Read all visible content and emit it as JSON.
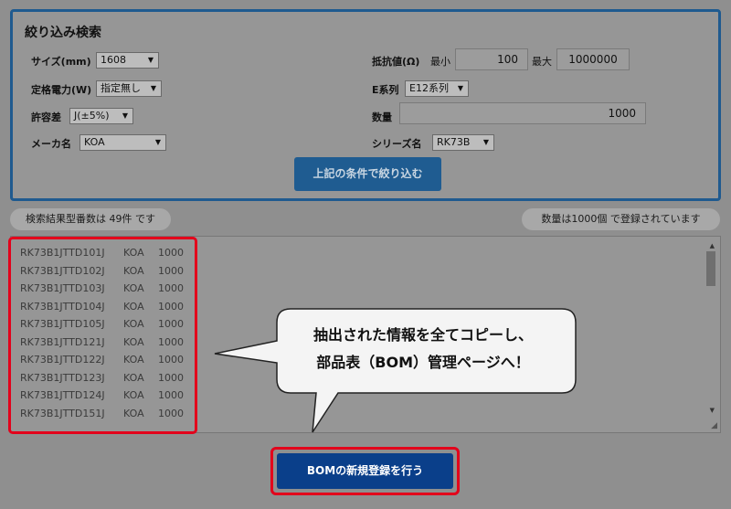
{
  "search": {
    "title": "絞り込み検索",
    "size": {
      "label": "サイズ(mm)",
      "value": "1608"
    },
    "power": {
      "label": "定格電力(W)",
      "value": "指定無し"
    },
    "tolerance": {
      "label": "許容差",
      "value": "J(±5%)"
    },
    "maker": {
      "label": "メーカ名",
      "value": "KOA"
    },
    "resistance": {
      "label": "抵抗値(Ω)",
      "min_label": "最小",
      "min_value": "100",
      "max_label": "最大",
      "max_value": "1000000"
    },
    "e_series": {
      "label": "E系列",
      "value": "E12系列"
    },
    "quantity": {
      "label": "数量",
      "value": "1000"
    },
    "series": {
      "label": "シリーズ名",
      "value": "RK73B"
    },
    "filter_button": "上記の条件で絞り込む"
  },
  "status": {
    "count_text": "検索結果型番数は 49件 です",
    "qty_text": "数量は1000個 で登録されています"
  },
  "results": [
    {
      "part": "RK73B1JTTD101J",
      "maker": "KOA",
      "qty": "1000"
    },
    {
      "part": "RK73B1JTTD102J",
      "maker": "KOA",
      "qty": "1000"
    },
    {
      "part": "RK73B1JTTD103J",
      "maker": "KOA",
      "qty": "1000"
    },
    {
      "part": "RK73B1JTTD104J",
      "maker": "KOA",
      "qty": "1000"
    },
    {
      "part": "RK73B1JTTD105J",
      "maker": "KOA",
      "qty": "1000"
    },
    {
      "part": "RK73B1JTTD121J",
      "maker": "KOA",
      "qty": "1000"
    },
    {
      "part": "RK73B1JTTD122J",
      "maker": "KOA",
      "qty": "1000"
    },
    {
      "part": "RK73B1JTTD123J",
      "maker": "KOA",
      "qty": "1000"
    },
    {
      "part": "RK73B1JTTD124J",
      "maker": "KOA",
      "qty": "1000"
    },
    {
      "part": "RK73B1JTTD151J",
      "maker": "KOA",
      "qty": "1000"
    }
  ],
  "callout": {
    "line1": "抽出された情報を全てコピーし、",
    "line2": "部品表（BOM）管理ページへ！"
  },
  "bom_button": "BOMの新規登録を行う",
  "icons": {
    "dropdown": "chevron-down-icon",
    "scroll_up": "arrow-up-icon",
    "scroll_down": "arrow-down-icon",
    "resize": "resize-grip-icon"
  },
  "colors": {
    "panel_border": "#1f5a8f",
    "filter_button": "#1f5c91",
    "bom_button": "#0a3f8a",
    "highlight": "#e3001b",
    "overlay": "#8f8f8f"
  }
}
